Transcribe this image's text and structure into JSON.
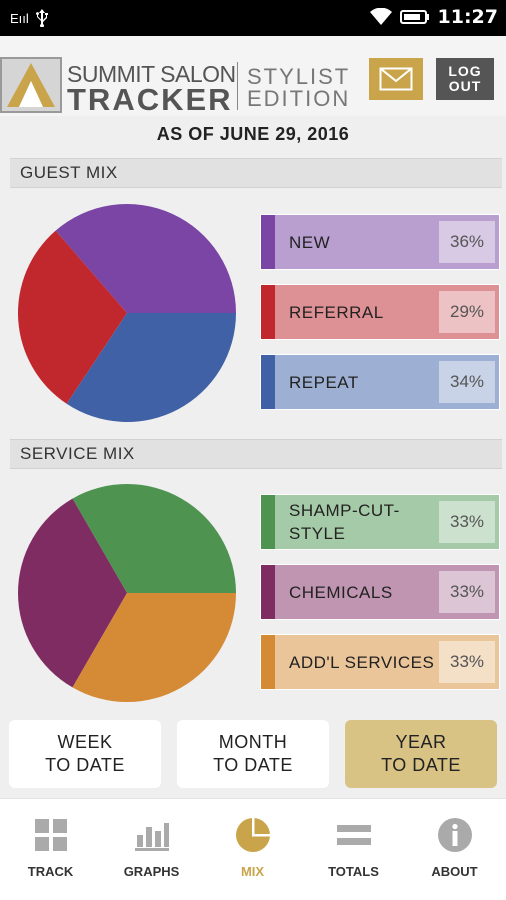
{
  "status_bar": {
    "carrier": "Eııl",
    "time": "11:27"
  },
  "header": {
    "brand_line1": "SUMMIT SALON",
    "brand_line2": "TRACKER",
    "edition_line1": "STYLIST",
    "edition_line2": "EDITION",
    "logout_line1": "LOG",
    "logout_line2": "OUT"
  },
  "as_of": "AS OF JUNE 29, 2016",
  "guest_mix": {
    "title": "GUEST MIX",
    "items": [
      {
        "label": "NEW",
        "percent": "36%",
        "value": 36,
        "color": "#7a45a4",
        "bg": "#b99fcf"
      },
      {
        "label": "REFERRAL",
        "percent": "29%",
        "value": 29,
        "color": "#c0282e",
        "bg": "#dd9194"
      },
      {
        "label": "REPEAT",
        "percent": "34%",
        "value": 34,
        "color": "#4061a5",
        "bg": "#9db0d3"
      }
    ]
  },
  "service_mix": {
    "title": "SERVICE MIX",
    "items": [
      {
        "label": "SHAMP-CUT-STYLE",
        "label_line1": "SHAMP-CUT-",
        "label_line2": "STYLE",
        "percent": "33%",
        "value": 33,
        "color": "#4e9450",
        "bg": "#a5caa7"
      },
      {
        "label": "CHEMICALS",
        "percent": "33%",
        "value": 33,
        "color": "#7e2c62",
        "bg": "#bf95b1"
      },
      {
        "label": "ADD'L SERVICES",
        "percent": "33%",
        "value": 33,
        "color": "#d58a35",
        "bg": "#ebc59a"
      }
    ]
  },
  "chart_data": [
    {
      "type": "pie",
      "title": "GUEST MIX",
      "categories": [
        "NEW",
        "REFERRAL",
        "REPEAT"
      ],
      "values": [
        36,
        29,
        34
      ],
      "colors": [
        "#7a45a4",
        "#c0282e",
        "#4061a5"
      ]
    },
    {
      "type": "pie",
      "title": "SERVICE MIX",
      "categories": [
        "SHAMP-CUT-STYLE",
        "CHEMICALS",
        "ADD'L SERVICES"
      ],
      "values": [
        33,
        33,
        33
      ],
      "colors": [
        "#4e9450",
        "#7e2c62",
        "#d58a35"
      ]
    }
  ],
  "period_buttons": [
    {
      "line1": "WEEK",
      "line2": "TO DATE",
      "active": false
    },
    {
      "line1": "MONTH",
      "line2": "TO DATE",
      "active": false
    },
    {
      "line1": "YEAR",
      "line2": "TO DATE",
      "active": true
    }
  ],
  "nav": {
    "items": [
      {
        "label": "TRACK",
        "icon": "grid-icon"
      },
      {
        "label": "GRAPHS",
        "icon": "bar-chart-icon"
      },
      {
        "label": "MIX",
        "icon": "pie-chart-icon",
        "active": true
      },
      {
        "label": "TOTALS",
        "icon": "equals-icon"
      },
      {
        "label": "ABOUT",
        "icon": "info-icon"
      }
    ]
  },
  "colors": {
    "accent_gold": "#c9a44a",
    "active_period_bg": "#d8c385",
    "logout_bg": "#555555"
  }
}
